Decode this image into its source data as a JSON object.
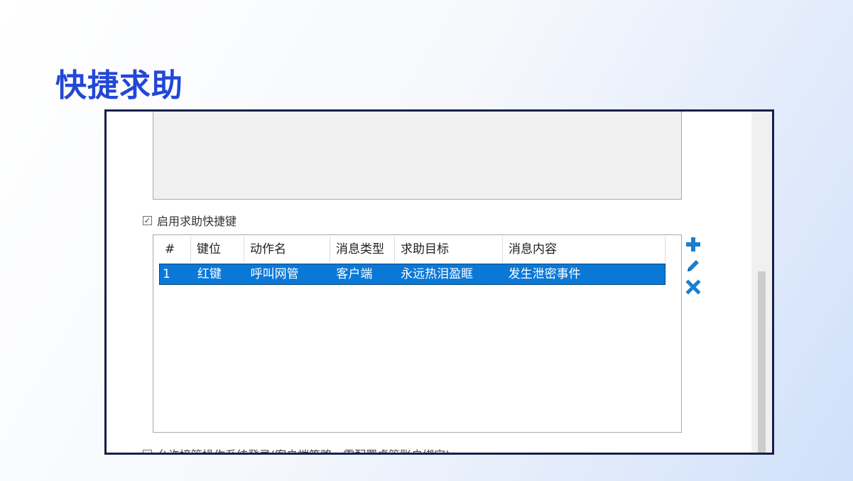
{
  "slide": {
    "title": "快捷求助"
  },
  "dialog": {
    "enable_checkbox": {
      "label": "启用求助快捷键",
      "checked": true,
      "check_glyph": "✓"
    },
    "table": {
      "columns": [
        "#",
        "键位",
        "动作名",
        "消息类型",
        "求助目标",
        "消息内容"
      ],
      "rows": [
        {
          "cells": [
            "1",
            "红键",
            "呼叫网管",
            "客户端",
            "永远热泪盈眶",
            "发生泄密事件"
          ],
          "selected": true
        }
      ]
    },
    "tools": [
      {
        "name": "add-icon",
        "color": "#1a7fd1"
      },
      {
        "name": "edit-pencil-icon",
        "color": "#1a7fd1"
      },
      {
        "name": "delete-x-icon",
        "color": "#1a7fd1"
      }
    ],
    "bottom_checkbox": {
      "label": "允许接管操作系统登录(客户端策略，需配置桌管账户绑定)",
      "checked": false
    }
  }
}
